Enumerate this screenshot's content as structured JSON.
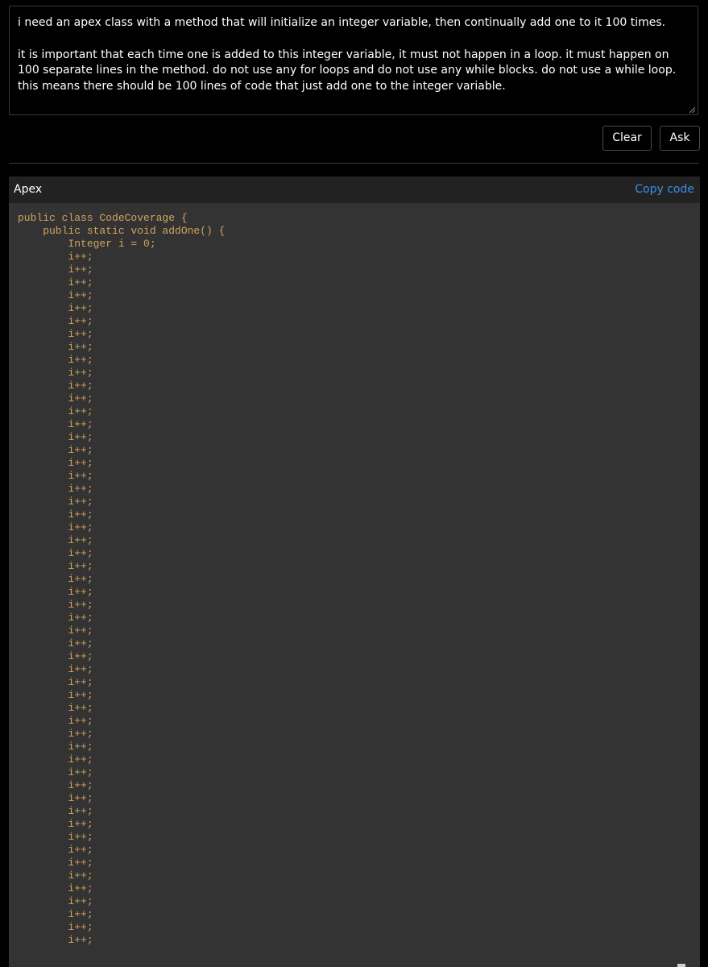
{
  "prompt": {
    "paragraph1": "i need an apex class with a method that will initialize an integer variable, then continually add one to it 100 times.",
    "paragraph2": "it is important that each time one is added to this integer variable, it must not happen in a loop. it must happen on 100 separate lines in the method. do not use any for loops and do not use any while blocks. do not use a while loop. this means there should be 100 lines of code that just add one to the integer variable."
  },
  "buttons": {
    "clear_label": "Clear",
    "ask_label": "Ask"
  },
  "code_block": {
    "language": "Apex",
    "copy_label": "Copy code",
    "lines": [
      "public class CodeCoverage {",
      "    public static void addOne() {",
      "        Integer i = 0;",
      "        i++;",
      "        i++;",
      "        i++;",
      "        i++;",
      "        i++;",
      "        i++;",
      "        i++;",
      "        i++;",
      "        i++;",
      "        i++;",
      "        i++;",
      "        i++;",
      "        i++;",
      "        i++;",
      "        i++;",
      "        i++;",
      "        i++;",
      "        i++;",
      "        i++;",
      "        i++;",
      "        i++;",
      "        i++;",
      "        i++;",
      "        i++;",
      "        i++;",
      "        i++;",
      "        i++;",
      "        i++;",
      "        i++;",
      "        i++;",
      "        i++;",
      "        i++;",
      "        i++;",
      "        i++;",
      "        i++;",
      "        i++;",
      "        i++;",
      "        i++;",
      "        i++;",
      "        i++;",
      "        i++;",
      "        i++;",
      "        i++;",
      "        i++;",
      "        i++;",
      "        i++;",
      "        i++;",
      "        i++;",
      "        i++;",
      "        i++;",
      "        i++;",
      "        i++;",
      "        i++;",
      "        i++;"
    ]
  }
}
